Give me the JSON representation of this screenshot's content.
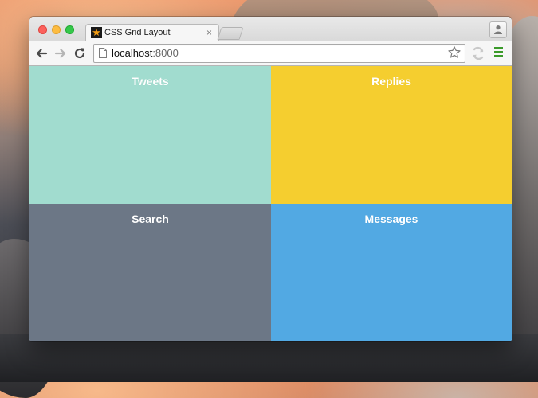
{
  "browser": {
    "tab": {
      "title": "CSS Grid Layout",
      "close_glyph": "×",
      "favicon_glyph": "★"
    },
    "address": {
      "host": "localhost",
      "port": ":8000"
    }
  },
  "grid": {
    "cells": [
      {
        "label": "Tweets",
        "color": "#a1dccf"
      },
      {
        "label": "Replies",
        "color": "#f5ce2f"
      },
      {
        "label": "Search",
        "color": "#6c7786"
      },
      {
        "label": "Messages",
        "color": "#52a9e3"
      }
    ]
  },
  "icons": {
    "back": "arrow-left-icon",
    "forward": "arrow-right-icon",
    "reload": "reload-icon",
    "bookmark": "star-icon",
    "menu": "hamburger-menu-icon",
    "profile": "person-icon",
    "extension": "extension-icon"
  }
}
